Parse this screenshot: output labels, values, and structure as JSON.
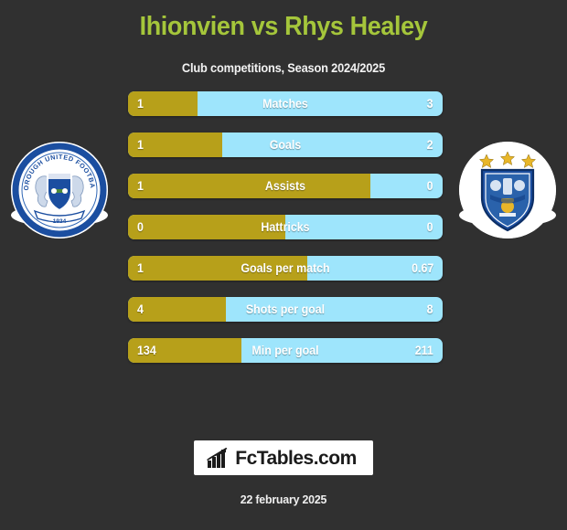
{
  "header": {
    "title": "Ihionvien vs Rhys Healey",
    "subtitle": "Club competitions, Season 2024/2025",
    "title_color": "#a5c63b"
  },
  "teams": {
    "left": {
      "crest_name": "peterborough-united-crest",
      "crest_text_ring": "PETERBOROUGH UNITED FOOTBALL CLUB",
      "crest_year": "1934"
    },
    "right": {
      "crest_name": "huddersfield-town-crest",
      "crest_stars": 3
    }
  },
  "colors": {
    "background": "#303030",
    "left_bar": "#b7a01a",
    "right_bar": "#9ee5fc",
    "value_text": "#ffffff"
  },
  "chart_data": {
    "type": "bar",
    "title": "Ihionvien vs Rhys Healey",
    "subtitle": "Club competitions, Season 2024/2025",
    "categories": [
      "Matches",
      "Goals",
      "Assists",
      "Hattricks",
      "Goals per match",
      "Shots per goal",
      "Min per goal"
    ],
    "series": [
      {
        "name": "Ihionvien",
        "values": [
          "1",
          "1",
          "1",
          "0",
          "1",
          "4",
          "134"
        ]
      },
      {
        "name": "Rhys Healey",
        "values": [
          "3",
          "2",
          "0",
          "0",
          "0.67",
          "8",
          "211"
        ]
      }
    ],
    "legend": "none",
    "grid": false
  },
  "stats": [
    {
      "label": "Matches",
      "left": "1",
      "right": "3",
      "left_pct": 22
    },
    {
      "label": "Goals",
      "left": "1",
      "right": "2",
      "left_pct": 30
    },
    {
      "label": "Assists",
      "left": "1",
      "right": "0",
      "left_pct": 77
    },
    {
      "label": "Hattricks",
      "left": "0",
      "right": "0",
      "left_pct": 50
    },
    {
      "label": "Goals per match",
      "left": "1",
      "right": "0.67",
      "left_pct": 57
    },
    {
      "label": "Shots per goal",
      "left": "4",
      "right": "8",
      "left_pct": 31
    },
    {
      "label": "Min per goal",
      "left": "134",
      "right": "211",
      "left_pct": 36
    }
  ],
  "footer": {
    "logo_text": "FcTables.com",
    "logo_icon": "bar-chart-arrow-icon",
    "date": "22 february 2025"
  }
}
